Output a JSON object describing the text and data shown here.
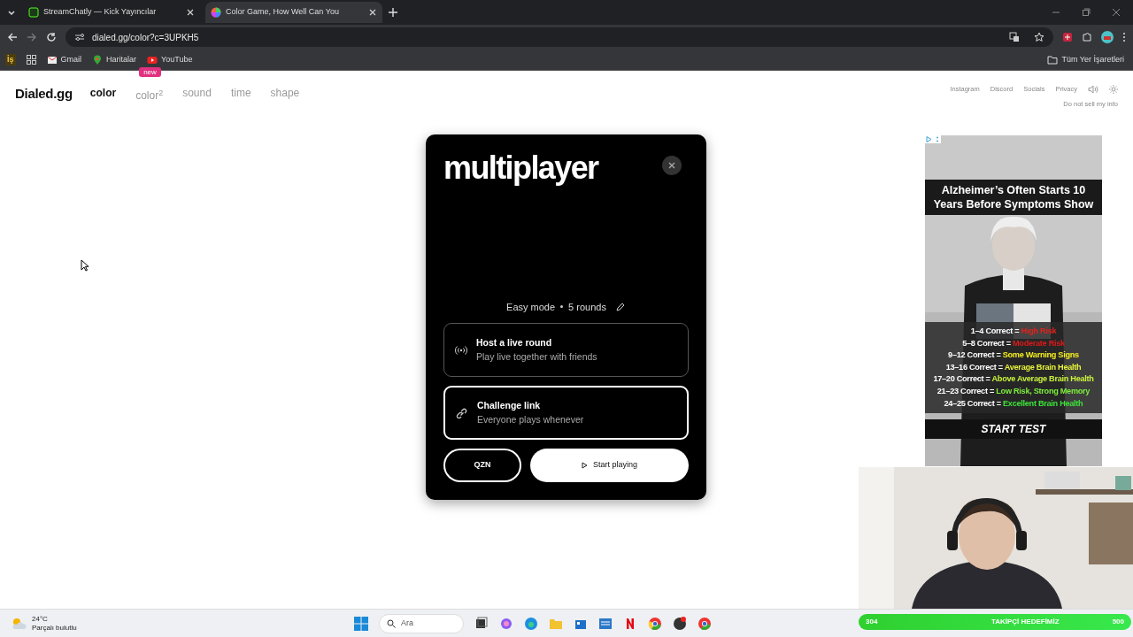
{
  "browser": {
    "tabs": [
      {
        "title": "StreamChatly — Kick Yayıncılar",
        "selected": false
      },
      {
        "title": "Color Game, How Well Can You",
        "selected": true
      }
    ],
    "url": "dialed.gg/color?c=3UPKH5",
    "bookmarks": [
      "Gmail",
      "Haritalar",
      "YouTube"
    ],
    "apps_badge": "İş",
    "all_bookmarks": "Tüm Yer İşaretleri"
  },
  "site": {
    "logo": "Dialed.gg",
    "nav": [
      {
        "label": "color",
        "selected": true
      },
      {
        "label": "color$^{2}$",
        "selected": false,
        "badge": "new"
      },
      {
        "label": "sound",
        "selected": false
      },
      {
        "label": "time",
        "selected": false
      },
      {
        "label": "shape",
        "selected": false
      }
    ],
    "links": [
      "Instagram",
      "Discord",
      "Socials",
      "Privacy"
    ],
    "privacy_note": "Do not sell my info"
  },
  "modal": {
    "title": "multiplayer",
    "mode": "Easy mode",
    "rounds": "5 rounds",
    "options": [
      {
        "kind": "live",
        "title": "Host a live round",
        "subtitle": "Play live together with friends",
        "selected": false
      },
      {
        "kind": "link",
        "title": "Challenge link",
        "subtitle": "Everyone plays whenever",
        "selected": true
      }
    ],
    "code_button": "QZN",
    "start_button": "Start playing"
  },
  "ad": {
    "headline": "Alzheimer’s Often Starts 10 Years Before Symptoms Show",
    "score_lines": [
      {
        "range": "1–4 Correct =",
        "result": "High Risk",
        "color": "#e0221c"
      },
      {
        "range": "5–8 Correct =",
        "result": "Moderate Risk",
        "color": "#d91a1a"
      },
      {
        "range": "9–12 Correct =",
        "result": "Some Warning Signs",
        "color": "#f2ee1e"
      },
      {
        "range": "13–16 Correct =",
        "result": "Average Brain Health",
        "color": "#e4f238"
      },
      {
        "range": "17–20 Correct =",
        "result": "Above Average Brain Health",
        "color": "#c6f03c"
      },
      {
        "range": "21–23 Correct =",
        "result": "Low Risk, Strong Memory",
        "color": "#7cec3c"
      },
      {
        "range": "24–25 Correct =",
        "result": "Excellent Brain Health",
        "color": "#3ee03a"
      }
    ],
    "cta": "START TEST"
  },
  "taskbar": {
    "temperature": "24°C",
    "condition": "Parçalı bulutlu",
    "search_placeholder": "Ara",
    "stream_goal": {
      "current": "304",
      "label": "TAKİPÇİ HEDEFİMİZ",
      "target": "500"
    }
  }
}
